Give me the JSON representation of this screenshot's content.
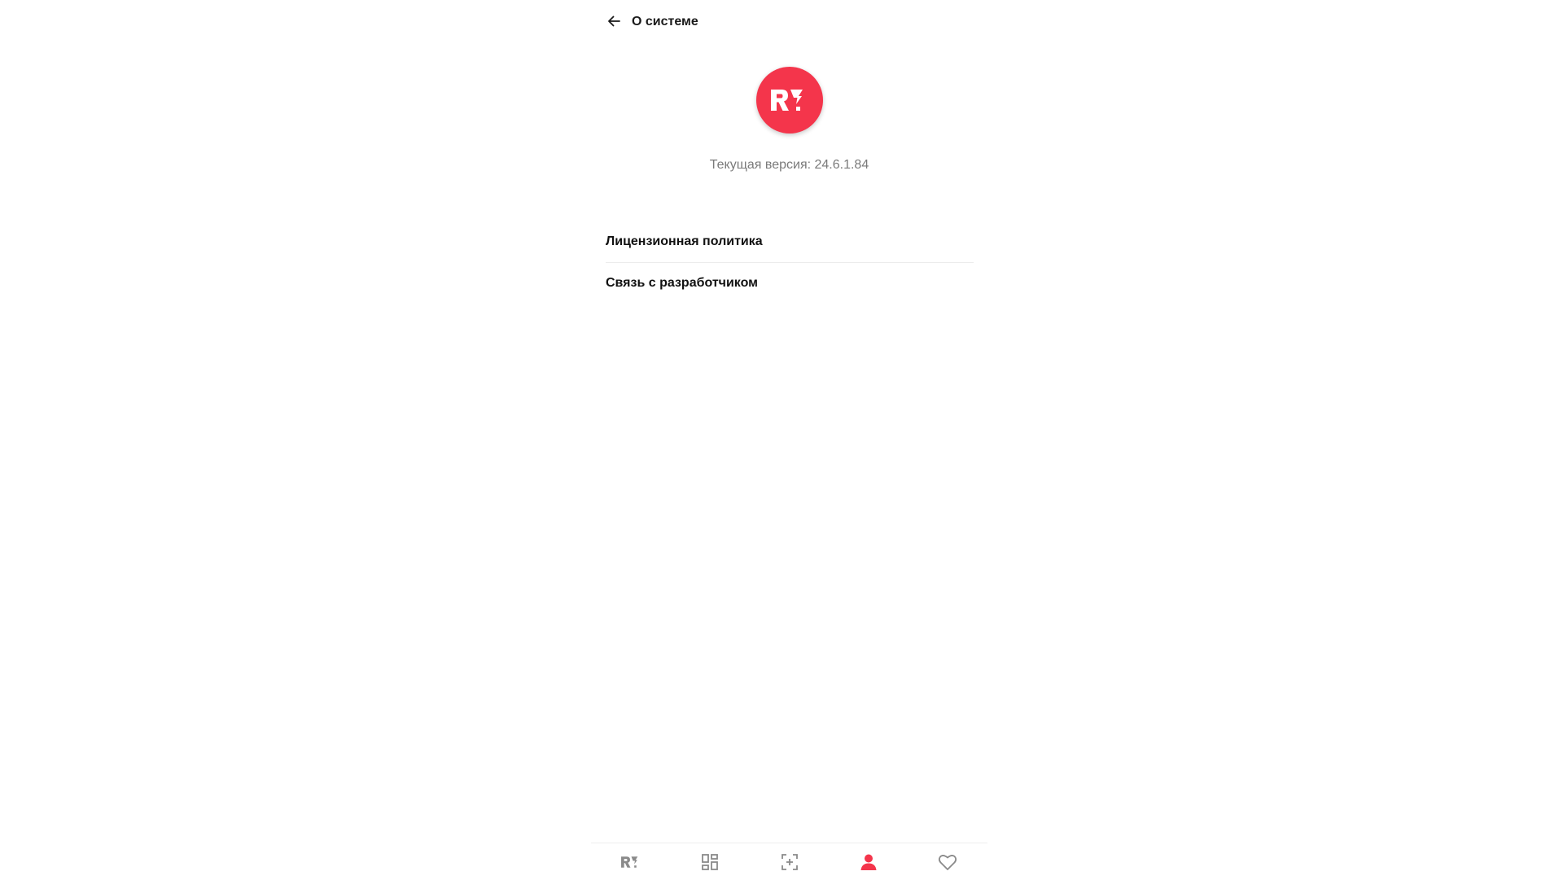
{
  "header": {
    "title": "О системе",
    "back_icon": "arrow-left-icon"
  },
  "logo": {
    "icon": "app-logo-icon",
    "color": "#f4354b"
  },
  "version_text": "Текущая версия: 24.6.1.84",
  "menu": {
    "items": [
      {
        "label": "Лицензионная политика"
      },
      {
        "label": "Связь с разработчиком"
      }
    ]
  },
  "bottom_nav": {
    "items": [
      {
        "icon": "home-logo-icon",
        "active": false
      },
      {
        "icon": "catalog-grid-icon",
        "active": false
      },
      {
        "icon": "scan-add-icon",
        "active": false
      },
      {
        "icon": "profile-icon",
        "active": true
      },
      {
        "icon": "favorites-heart-icon",
        "active": false
      }
    ],
    "active_color": "#f4354b",
    "inactive_color": "#8a8a8a"
  }
}
